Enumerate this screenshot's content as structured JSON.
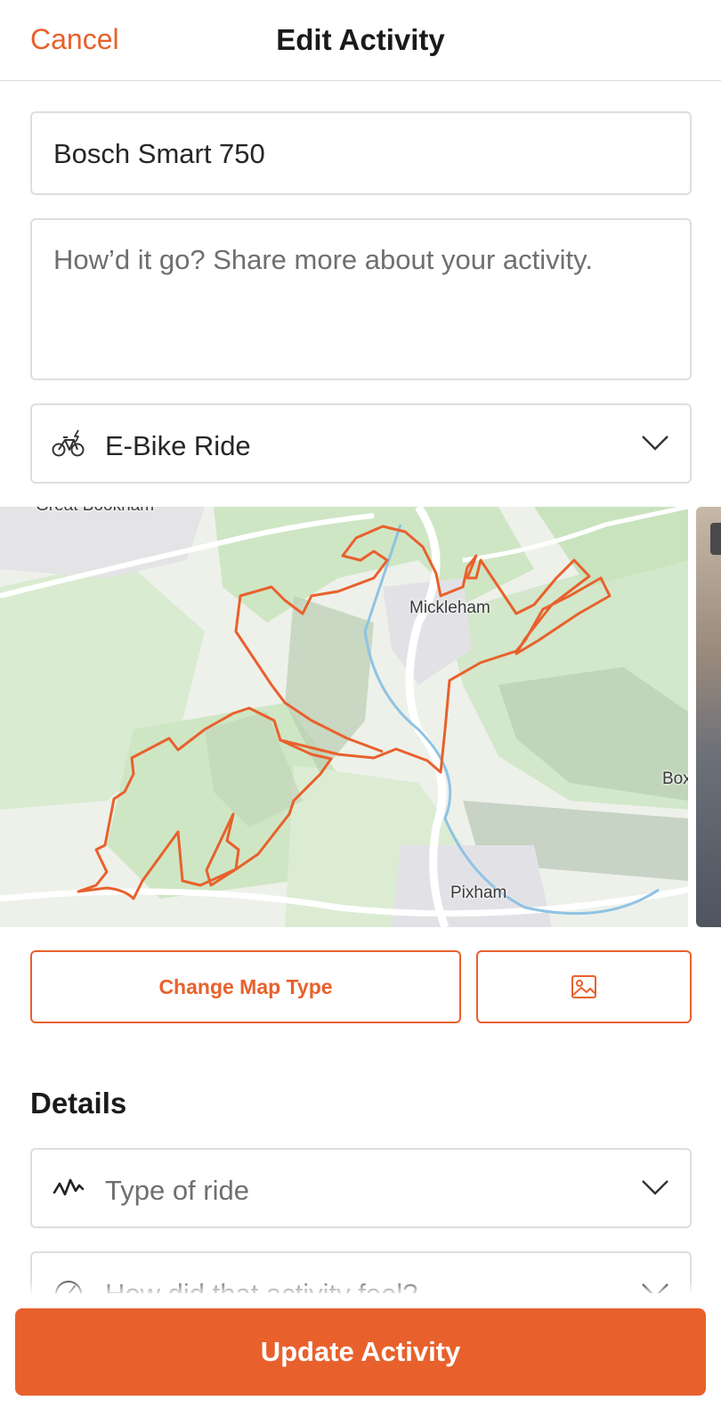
{
  "header": {
    "cancel_label": "Cancel",
    "title": "Edit Activity"
  },
  "form": {
    "activity_name": "Bosch Smart 750",
    "description_placeholder": "How’d it go? Share more about your activity.",
    "sport_type": "E-Bike Ride"
  },
  "map": {
    "labels": {
      "top_left": "Great Bookham",
      "mickleham": "Mickleham",
      "pixham": "Pixham",
      "box": "Box"
    },
    "route_color": "#e8612c"
  },
  "map_actions": {
    "change_map_type_label": "Change Map Type",
    "add_photo_icon": "image-icon"
  },
  "details": {
    "heading": "Details",
    "ride_type_placeholder": "Type of ride",
    "feel_placeholder": "How did that activity feel?"
  },
  "footer": {
    "update_label": "Update Activity"
  },
  "colors": {
    "accent": "#e8612c",
    "border": "#dedede",
    "placeholder": "#6f6f6f"
  }
}
